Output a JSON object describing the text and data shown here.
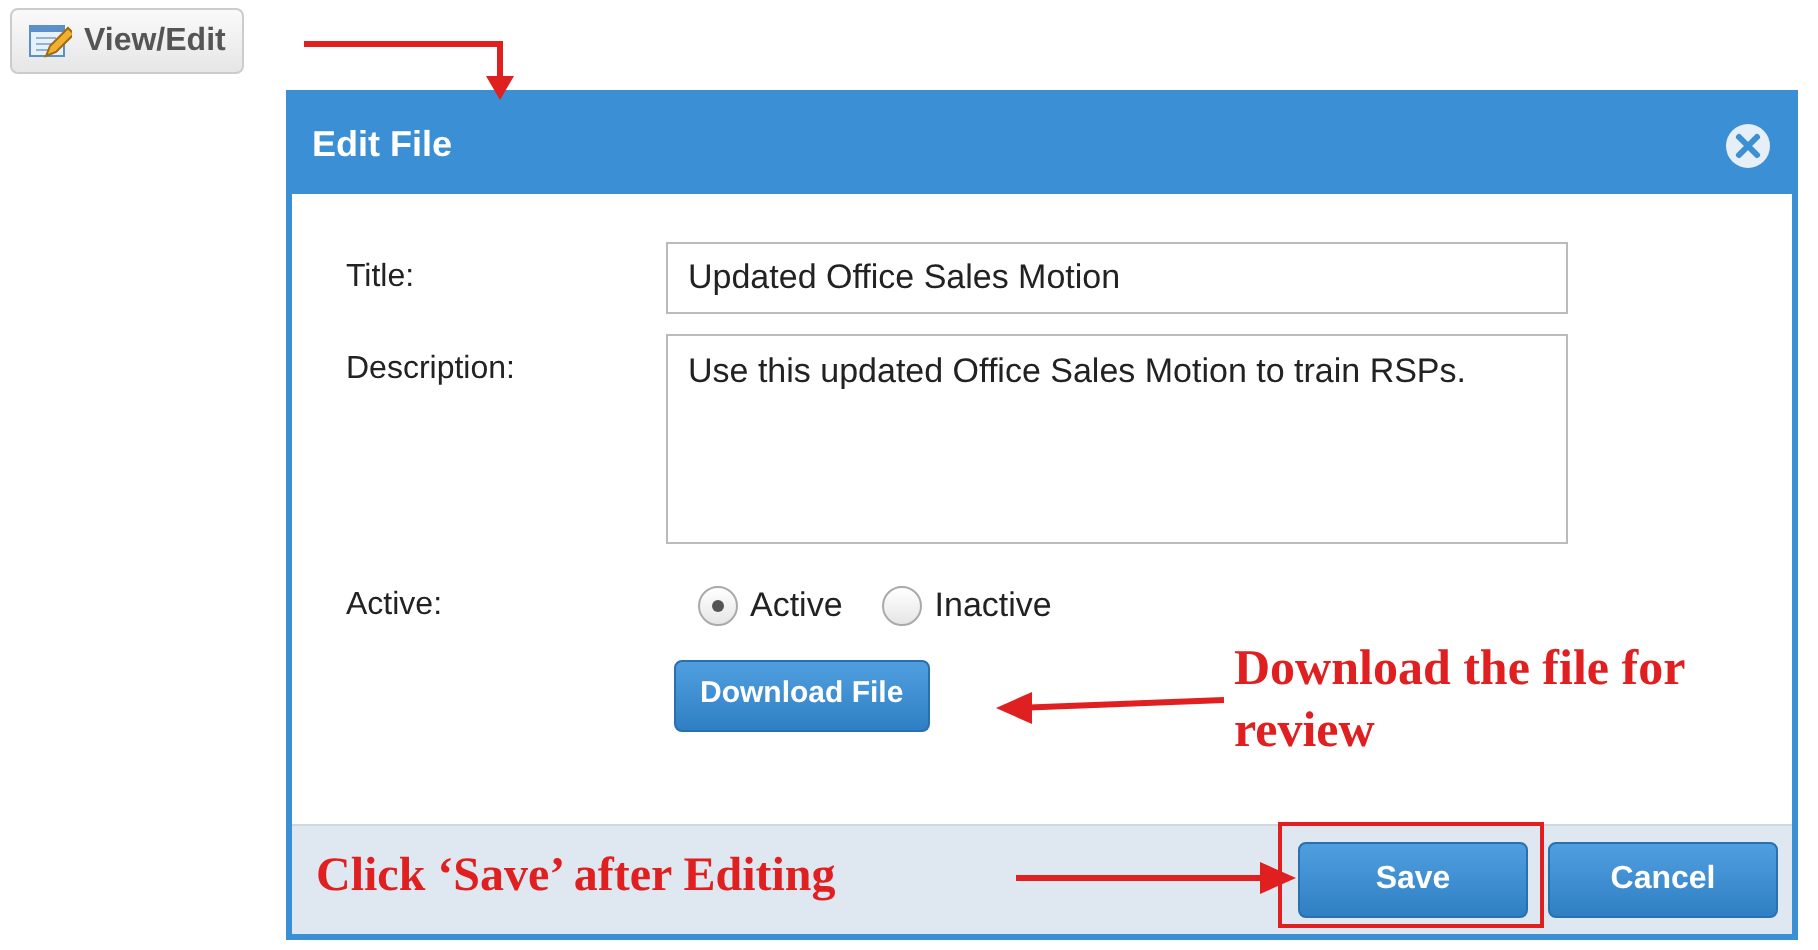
{
  "trigger_button": {
    "label": "View/Edit"
  },
  "dialog": {
    "title": "Edit File",
    "fields": [
      {
        "label": "Title:",
        "kind": "input",
        "value": "Updated Office Sales Motion"
      },
      {
        "label": "Description:",
        "kind": "textarea",
        "value": "Use this updated Office Sales Motion to train RSPs."
      }
    ],
    "active": {
      "label": "Active:",
      "options": [
        {
          "label": "Active",
          "selected": true
        },
        {
          "label": "Inactive",
          "selected": false
        }
      ]
    },
    "download_button": "Download File",
    "footer_buttons": [
      "Save",
      "Cancel"
    ]
  },
  "annotations": [
    {
      "text": "Download the file for review"
    },
    {
      "text": "Click ‘Save’ after Editing"
    }
  ]
}
